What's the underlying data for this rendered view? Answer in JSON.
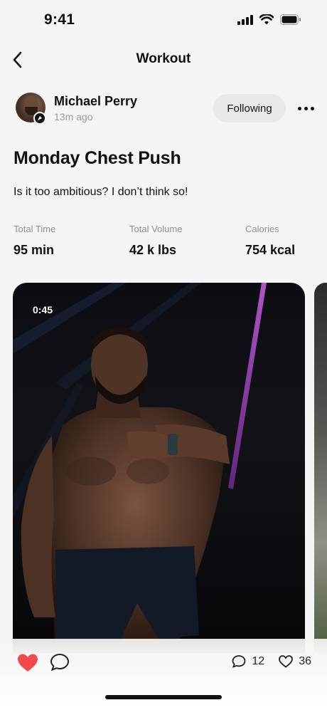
{
  "status_bar": {
    "time": "9:41"
  },
  "nav": {
    "title": "Workout",
    "back_icon": "chevron-left-icon"
  },
  "author": {
    "name": "Michael Perry",
    "time_ago": "13m ago",
    "follow_label": "Following"
  },
  "post": {
    "title": "Monday Chest Push",
    "description": "Is it too ambitious? I don’t think so!"
  },
  "stats": [
    {
      "label": "Total Time",
      "value": "95 min"
    },
    {
      "label": "Total Volume",
      "value": "42 k lbs"
    },
    {
      "label": "Calories",
      "value": "754 kcal"
    }
  ],
  "media": {
    "duration": "0:45"
  },
  "engagement": {
    "comments": "12",
    "likes": "36",
    "like_color": "#f04a4a",
    "liked": true
  }
}
